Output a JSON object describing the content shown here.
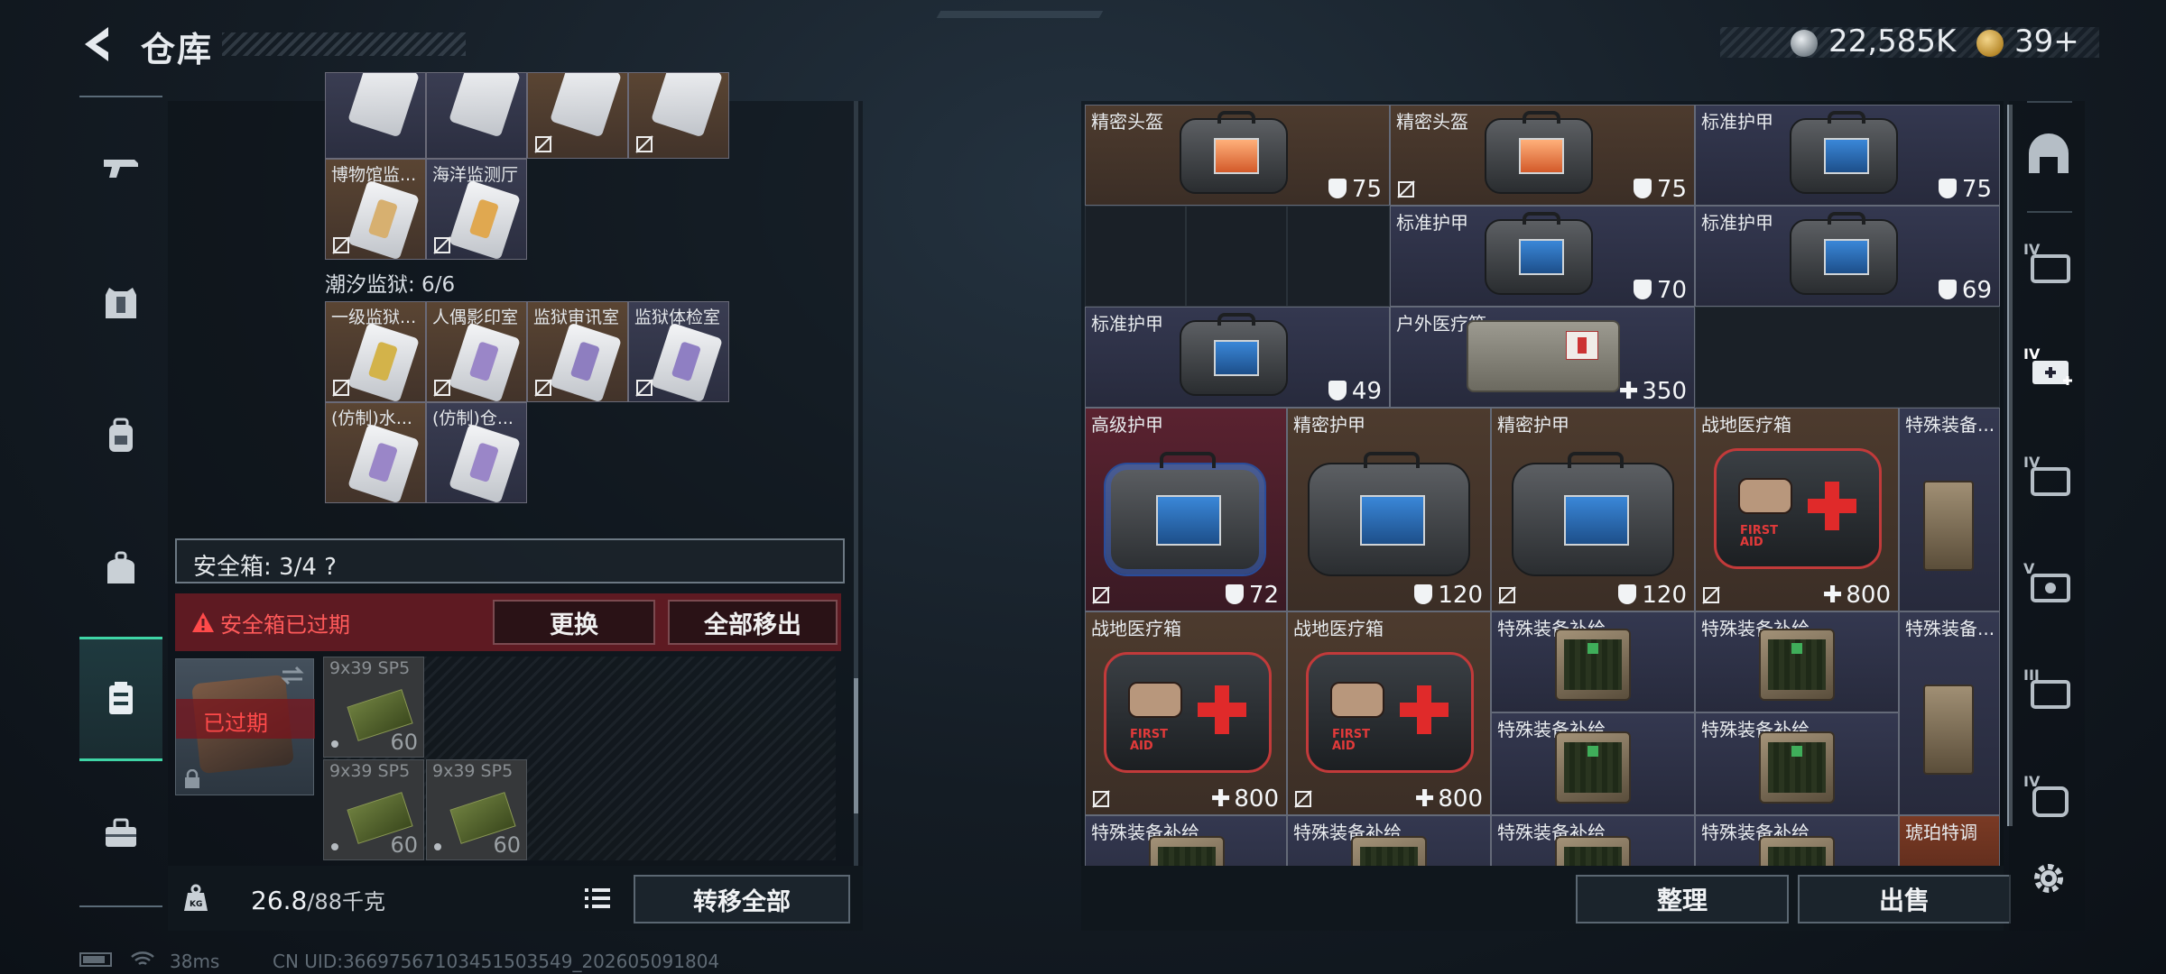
{
  "header": {
    "title": "仓库"
  },
  "currency": {
    "silver": "22,585K",
    "gold": "39+"
  },
  "left_nav": [
    "gun-icon",
    "vest-icon",
    "backpack-icon",
    "bag-icon",
    "case-icon",
    "toolbox-icon"
  ],
  "top_group_cards": [
    {
      "label": "",
      "color": "navy"
    },
    {
      "label": "",
      "color": "navy"
    },
    {
      "label": "",
      "color": "brown"
    },
    {
      "label": "",
      "color": "brown"
    },
    {
      "label": "博物馆监...",
      "color": "brown"
    },
    {
      "label": "海洋监测厅",
      "color": "navy"
    }
  ],
  "prison_group": {
    "title": "潮汐监狱: 6/6",
    "cards": [
      {
        "label": "一级监狱...",
        "color": "brown",
        "stripe": "#d3b34a"
      },
      {
        "label": "人偶影印室",
        "color": "brown",
        "stripe": "#9a86c8"
      },
      {
        "label": "监狱审讯室",
        "color": "brown",
        "stripe": "#8e7ec0"
      },
      {
        "label": "监狱体检室",
        "color": "navy",
        "stripe": "#8f7fc3"
      },
      {
        "label": "(仿制)水...",
        "color": "brown",
        "stripe": "#9a86c8"
      },
      {
        "label": "(仿制)仓...",
        "color": "navy",
        "stripe": "#9a86c8"
      }
    ]
  },
  "safe_box": {
    "label": "安全箱: 3/4 ?",
    "expired_text": "安全箱已过期",
    "replace_label": "更换",
    "remove_all_label": "全部移出",
    "expired_badge": "已过期"
  },
  "ammo": [
    {
      "name": "9x39 SP5",
      "count": "60"
    },
    {
      "name": "9x39 SP5",
      "count": "60"
    },
    {
      "name": "9x39 SP5",
      "count": "60"
    }
  ],
  "footer_left": {
    "weight": "26.8",
    "capacity": "/88千克",
    "transfer_label": "转移全部"
  },
  "status": {
    "ping": "38ms",
    "uid": "CN UID:36697567103451503549_202605091804"
  },
  "inventory": {
    "row1": [
      {
        "label": "精密头盔",
        "value": "75",
        "color": "brown"
      },
      {
        "label": "精密头盔",
        "value": "75",
        "color": "brown"
      },
      {
        "label": "标准护甲",
        "value": "75",
        "color": "navy"
      }
    ],
    "row2": [
      {
        "label": "标准护甲",
        "value": "70",
        "color": "navy"
      },
      {
        "label": "标准护甲",
        "value": "69",
        "color": "navy"
      }
    ],
    "row3": [
      {
        "label": "标准护甲",
        "value": "49",
        "color": "navy"
      },
      {
        "label": "户外医疗箱",
        "value": "350",
        "color": "navy"
      }
    ],
    "row4": [
      {
        "label": "高级护甲",
        "value": "72",
        "color": "red"
      },
      {
        "label": "精密护甲",
        "value": "120",
        "color": "brown"
      },
      {
        "label": "精密护甲",
        "value": "120",
        "color": "brown"
      },
      {
        "label": "战地医疗箱",
        "value": "800",
        "color": "brown"
      },
      {
        "label": "特殊装备...",
        "value": "",
        "color": "navy"
      }
    ],
    "row5": [
      {
        "label": "战地医疗箱",
        "value": "800",
        "color": "brown"
      },
      {
        "label": "战地医疗箱",
        "value": "800",
        "color": "brown"
      },
      {
        "label": "特殊装备补给",
        "value": "",
        "color": "navy"
      },
      {
        "label": "特殊装备补给",
        "value": "",
        "color": "navy"
      },
      {
        "label": "特殊装备...",
        "value": "",
        "color": "navy"
      },
      {
        "label": "特殊装备补给",
        "value": "",
        "color": "navy"
      },
      {
        "label": "特殊装备补给",
        "value": "",
        "color": "navy"
      }
    ],
    "row6": [
      {
        "label": "特殊装备补给",
        "color": "navy"
      },
      {
        "label": "特殊装备补给",
        "color": "navy"
      },
      {
        "label": "特殊装备补给",
        "color": "navy"
      },
      {
        "label": "特殊装备补给",
        "color": "navy"
      },
      {
        "label": "琥珀特调",
        "color": "orange"
      }
    ]
  },
  "footer_right": {
    "sort_label": "整理",
    "sell_label": "出售"
  },
  "right_nav": [
    "helmet-slot-icon",
    "IV",
    "IV",
    "IV",
    "V",
    "III",
    "IV"
  ]
}
